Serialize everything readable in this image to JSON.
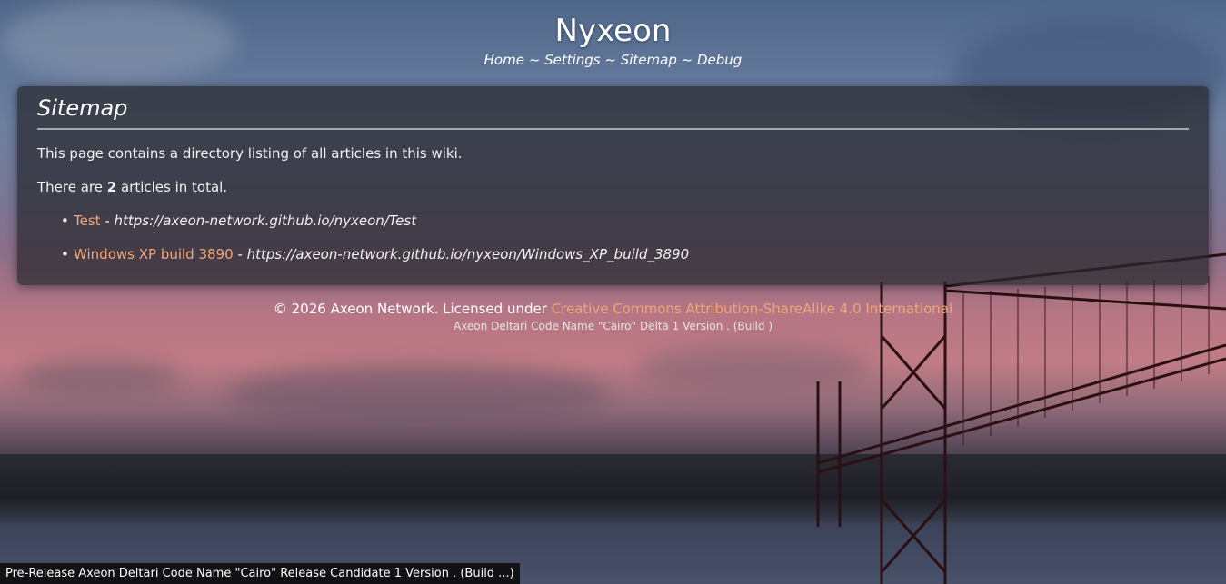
{
  "site": {
    "title": "Nyxeon"
  },
  "nav": {
    "items": [
      "Home",
      "Settings",
      "Sitemap",
      "Debug"
    ],
    "separator": "~"
  },
  "panel": {
    "heading": "Sitemap",
    "intro": "This page contains a directory listing of all articles in this wiki.",
    "count_prefix": "There are ",
    "count": "2",
    "count_suffix": " articles in total.",
    "articles": [
      {
        "title": "Test",
        "dash": " - ",
        "url": "https://axeon-network.github.io/nyxeon/Test"
      },
      {
        "title": "Windows XP build 3890",
        "dash": " - ",
        "url": "https://axeon-network.github.io/nyxeon/Windows_XP_build_3890"
      }
    ]
  },
  "footer": {
    "copyright_prefix": "© 2026 Axeon Network. Licensed under ",
    "license_link": "Creative Commons Attribution-ShareAlike 4.0 International",
    "build_line": "Axeon Deltari Code Name \"Cairo\" Delta 1 Version . (Build )"
  },
  "prerelease_banner": "Pre-Release Axeon Deltari Code Name \"Cairo\" Release Candidate 1 Version . (Build ...)",
  "colors": {
    "link": "#f0a67a",
    "panel_bg": "rgba(40,40,46,0.72)",
    "banner_bg": "#121214"
  }
}
